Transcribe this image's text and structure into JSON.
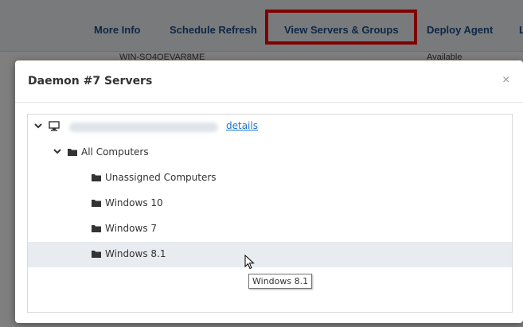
{
  "toolbar": {
    "tabs": [
      {
        "label": "More Info"
      },
      {
        "label": "Schedule Refresh"
      },
      {
        "label": "View Servers & Groups"
      },
      {
        "label": "Deploy Agent"
      },
      {
        "label": "L"
      }
    ],
    "highlight_color": "#ff0000"
  },
  "background_row": {
    "server_name": "WIN-SO4OEVAR8ME",
    "status": "Available"
  },
  "modal": {
    "title": "Daemon #7 Servers",
    "close_symbol": "×",
    "tree": {
      "root": {
        "details_label": "details",
        "icon": "monitor-icon"
      },
      "group": {
        "label": "All Computers",
        "icon": "folder-icon"
      },
      "children": [
        {
          "label": "Unassigned Computers",
          "icon": "folder-icon"
        },
        {
          "label": "Windows 10",
          "icon": "folder-icon"
        },
        {
          "label": "Windows 7",
          "icon": "folder-icon"
        },
        {
          "label": "Windows 8.1",
          "icon": "folder-icon",
          "selected": true
        }
      ]
    },
    "tooltip": "Windows 8.1"
  }
}
